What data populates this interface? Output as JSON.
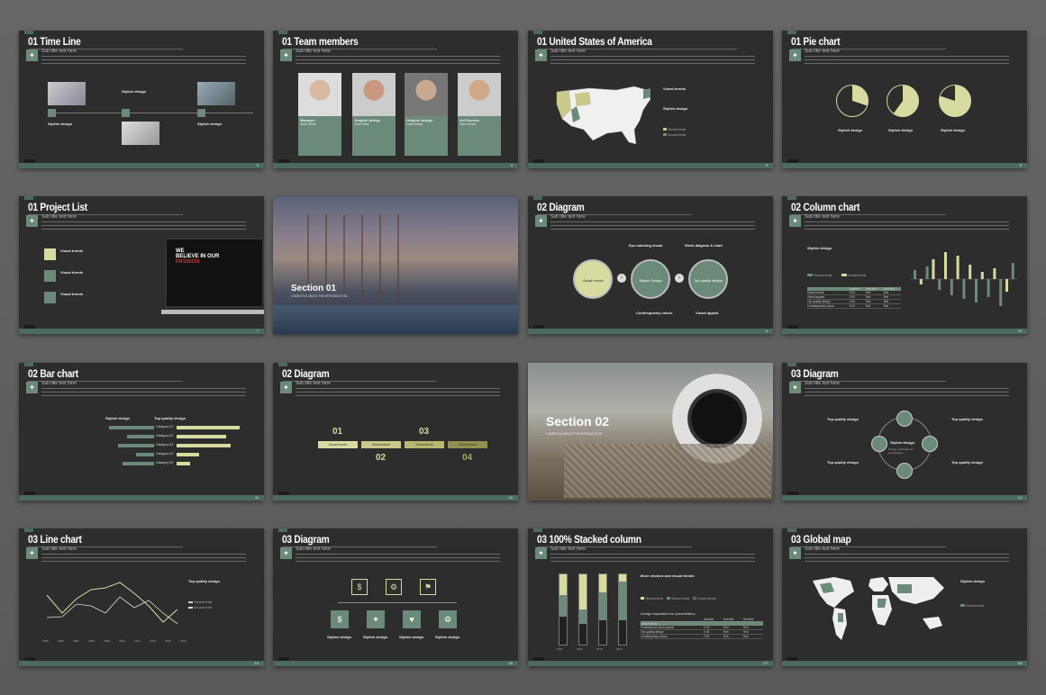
{
  "slides": [
    {
      "num": "01",
      "title": "Time Line",
      "subtitle": "Sub title text here",
      "page": "3",
      "labels": {
        "center": "Stylish design",
        "left": "Stylish design",
        "right": "Stylish design"
      }
    },
    {
      "num": "01",
      "title": "Team members",
      "subtitle": "Sub title text here",
      "page": "4",
      "members": [
        {
          "role": "Manager",
          "name": "John Dome"
        },
        {
          "role": "Graphic design",
          "name": "Jean Hose"
        },
        {
          "role": "Graphic design",
          "name": "John Dome"
        },
        {
          "role": "Art Director",
          "name": "John Dome"
        }
      ]
    },
    {
      "num": "01",
      "title": "United States of America",
      "subtitle": "Sub title text here",
      "page": "5",
      "right_title": "Visual trends",
      "right_sub": "Stylish design",
      "legend": [
        "Visual trends",
        "Visual trends"
      ]
    },
    {
      "num": "01",
      "title": "Pie chart",
      "subtitle": "Sub title text here",
      "page": "6",
      "labels": [
        "Stylish design",
        "Stylish design",
        "Stylish design"
      ]
    },
    {
      "num": "01",
      "title": "Project List",
      "subtitle": "Sub title text here",
      "page": "7",
      "items": [
        "Visual trends",
        "Visual trends",
        "Visual trends"
      ],
      "screen_text": [
        "WE",
        "BELIEVE IN OUR",
        "PASSION"
      ]
    },
    {
      "section_title": "Section 01",
      "section_sub": "A SUBTITLE ABOUT THE INTRODUCTION"
    },
    {
      "num": "02",
      "title": "Diagram",
      "subtitle": "Sub title text here",
      "page": "9",
      "top_left": "Eye-catching visual",
      "top_right": "Sleek diagram & chart",
      "circles": [
        "Visual trends",
        "Stylish Design",
        "Top quality design"
      ],
      "bottom_center": "Contemporary colors",
      "bottom_right": "Visual appeal"
    },
    {
      "num": "02",
      "title": "Column chart",
      "subtitle": "Sub title text here",
      "page": "10",
      "heading": "Stylish design",
      "legend": [
        "Visual trends",
        "Visual trends"
      ],
      "table_header": [
        "Number",
        "Total title",
        "Total title"
      ],
      "table_rows": [
        [
          "Visual trends",
          "0.00",
          "Text",
          "Text"
        ],
        [
          "Visual appeal",
          "0.00",
          "Text",
          "Text"
        ],
        [
          "Top quality design",
          "0.00",
          "Text",
          "Text"
        ],
        [
          "Contemporary colors",
          "0.00",
          "Text",
          "Text"
        ]
      ]
    },
    {
      "num": "02",
      "title": "Bar chart",
      "subtitle": "Sub title text here",
      "page": "11",
      "left_head": "Stylish design",
      "right_head": "Top quality design",
      "categories": [
        "Category 01",
        "Category 02",
        "Category 03",
        "Category 04",
        "Category 05"
      ]
    },
    {
      "num": "02",
      "title": "Diagram",
      "subtitle": "Sub title text here",
      "page": "12",
      "steps": [
        "01",
        "02",
        "03",
        "04"
      ],
      "step_label": "Visual trends"
    },
    {
      "section_title": "Section 02",
      "section_sub": "A SUBTITLE ABOUT THE INTRODUCTION"
    },
    {
      "num": "03",
      "title": "Diagram",
      "subtitle": "Sub title text here",
      "page": "14",
      "labels": [
        "Top quality design",
        "Top quality design",
        "Top quality design",
        "Top quality design"
      ],
      "center": "Stylish design",
      "center_sub": "Design inspiration for presentation"
    },
    {
      "num": "03",
      "title": "Line chart",
      "subtitle": "Sub title text here",
      "page": "15",
      "right_head": "Top quality design",
      "legend": [
        "Visual trends",
        "Visual trends"
      ],
      "years": [
        "2005",
        "2006",
        "2007",
        "2008",
        "2009",
        "2010",
        "2011",
        "2012",
        "2013",
        "2014"
      ]
    },
    {
      "num": "03",
      "title": "Diagram",
      "subtitle": "Sub title text here",
      "page": "16",
      "labels": [
        "Stylish design",
        "Stylish design",
        "Stylish design",
        "Stylish design"
      ]
    },
    {
      "num": "03",
      "title": "100% Stacked column",
      "subtitle": "Sub title text here",
      "page": "17",
      "right_head": "More choices and visual trends",
      "legend": [
        "Visual trends",
        "Visual trends",
        "Visual trends"
      ],
      "table_title": "Design inspiration for presentation",
      "table_header": [
        "Number",
        "Text title",
        "Text title"
      ],
      "table_rows": [
        [
          "Visual trends",
          "",
          "",
          ""
        ],
        [
          "Professional visual appeal",
          "0.00",
          "Text",
          "Text"
        ],
        [
          "Top quality design",
          "0.00",
          "Text",
          "Text"
        ],
        [
          "Contemporary colors",
          "0.00",
          "Text",
          "Text"
        ]
      ],
      "years": [
        "2011",
        "2012",
        "2013",
        "2014"
      ]
    },
    {
      "num": "03",
      "title": "Global map",
      "subtitle": "Sub title text here",
      "page": "18",
      "right_head": "Stylish design",
      "legend": "Visual trends"
    }
  ],
  "colors": {
    "accent": "#d8dba0",
    "green": "#6b8a7a",
    "dark": "#2d2d2d"
  }
}
